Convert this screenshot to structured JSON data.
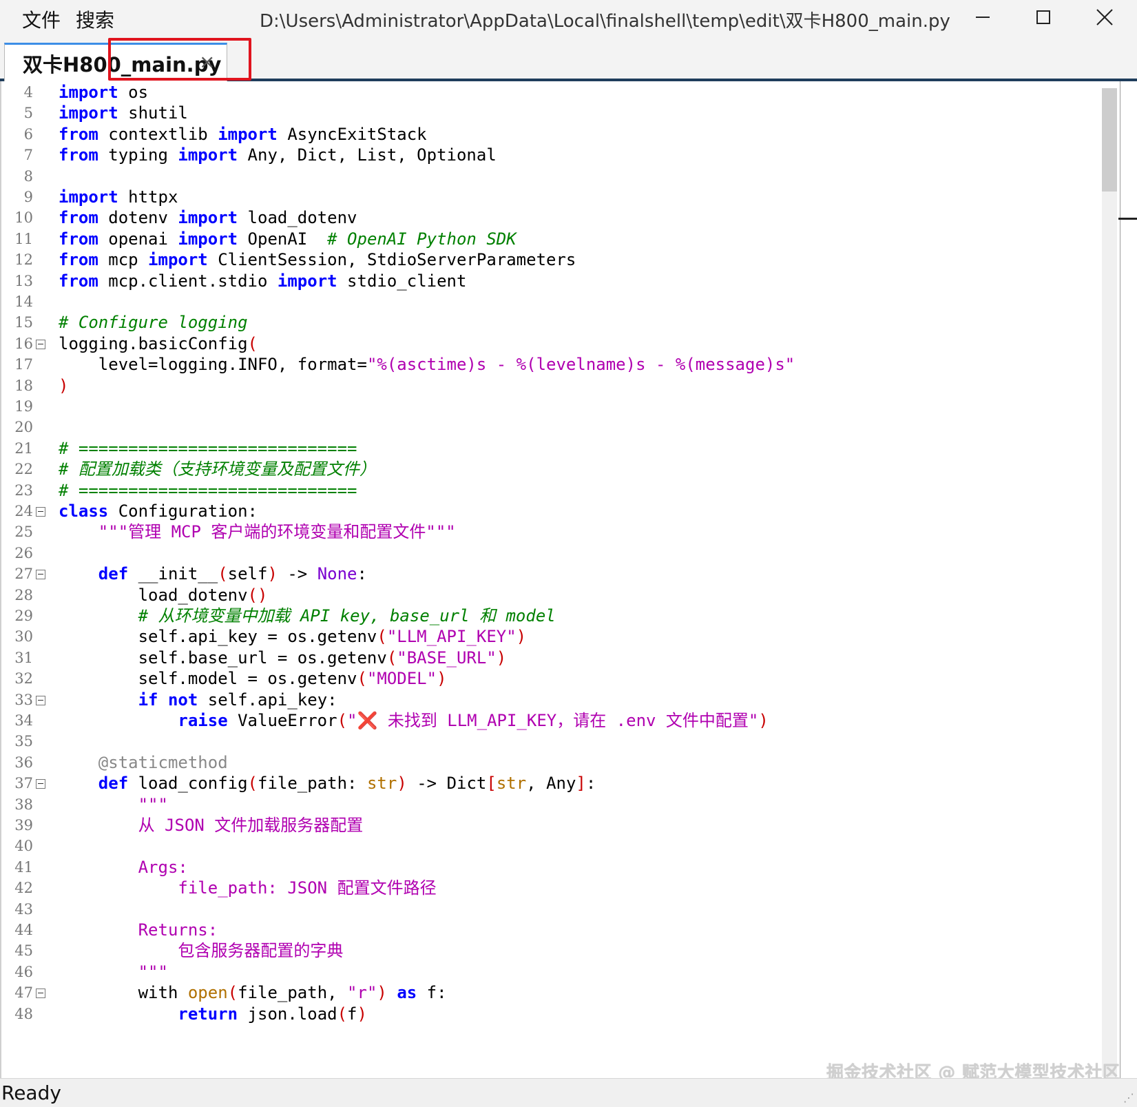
{
  "menu": {
    "file": "文件",
    "search": "搜索"
  },
  "window": {
    "title": "D:\\Users\\Administrator\\AppData\\Local\\finalshell\\temp\\edit\\双卡H800_main.py"
  },
  "tab": {
    "label": "双卡H800_main.py",
    "close": "×"
  },
  "status": {
    "text": "Ready"
  },
  "watermark": "掘金技术社区 @ 赋范大模型技术社区",
  "colors": {
    "keyword": "#0000ff",
    "comment": "#008000",
    "string": "#a31515",
    "docstring": "#b000b0",
    "highlight_box": "#e0141e",
    "tab_accent": "#3c8ee6"
  },
  "line_numbers": [
    "4",
    "5",
    "6",
    "7",
    "8",
    "9",
    "10",
    "11",
    "12",
    "13",
    "14",
    "15",
    "16",
    "17",
    "18",
    "19",
    "20",
    "21",
    "22",
    "23",
    "24",
    "25",
    "26",
    "27",
    "28",
    "29",
    "30",
    "31",
    "32",
    "33",
    "34",
    "35",
    "36",
    "37",
    "38",
    "39",
    "40",
    "41",
    "42",
    "43",
    "44",
    "45",
    "46",
    "47",
    "48"
  ],
  "code": {
    "import": "import",
    "from": "from",
    "class": "class",
    "def": "def",
    "if": "if",
    "not": "not",
    "raise": "raise",
    "return": "return",
    "as": "as",
    "l4": " os",
    "l5": " shutil",
    "l6a": " contextlib ",
    "l6b": " AsyncExitStack",
    "l7a": " typing ",
    "l7b": " Any, Dict, List, Optional",
    "l9": " httpx",
    "l10a": " dotenv ",
    "l10b": " load_dotenv",
    "l11a": " openai ",
    "l11b": " OpenAI  ",
    "l11c": "# OpenAI Python SDK",
    "l12a": " mcp ",
    "l12b": " ClientSession, StdioServerParameters",
    "l13a": " mcp.client.stdio ",
    "l13b": " stdio_client",
    "l15": "# Configure logging",
    "l16a": "logging.basicConfig",
    "l16b": "(",
    "l17a": "    level=logging.INFO, format=",
    "l17b": "\"%(asctime)s - %(levelname)s - %(message)s\"",
    "l18": ")",
    "l21": "# ============================",
    "l22": "# 配置加载类（支持环境变量及配置文件）",
    "l23": "# ============================",
    "l24": " Configuration:",
    "l25": "    \"\"\"管理 MCP 客户端的环境变量和配置文件\"\"\"",
    "l27a": "    ",
    "l27b": " __init__",
    "l27c": "(",
    "l27d": "self",
    "l27e": ")",
    "l27f": " -> ",
    "l27g": "None",
    "l27h": ":",
    "l28a": "        load_dotenv",
    "l28b": "()",
    "l29": "        # 从环境变量中加载 API key, base_url 和 model",
    "l30a": "        self.api_key = os.getenv",
    "l30b": "(",
    "l30c": "\"LLM_API_KEY\"",
    "l30d": ")",
    "l31a": "        self.base_url = os.getenv",
    "l31b": "(",
    "l31c": "\"BASE_URL\"",
    "l31d": ")",
    "l32a": "        self.model = os.getenv",
    "l32b": "(",
    "l32c": "\"MODEL\"",
    "l32d": ")",
    "l33a": "        ",
    "l33b": " self.api_key:",
    "l34a": "            ",
    "l34b": " ValueError",
    "l34c": "(",
    "l34d": "\"",
    "l34e": "❌",
    "l34f": " 未找到 LLM_API_KEY，请在 .env 文件中配置\"",
    "l34g": ")",
    "l36": "    @staticmethod",
    "l37a": "    ",
    "l37b": " load_config",
    "l37c": "(",
    "l37d": "file_path: ",
    "l37e": "str",
    "l37f": ")",
    "l37g": " -> Dict",
    "l37h": "[",
    "l37i": "str",
    "l37j": ", Any",
    "l37k": "]",
    "l37l": ":",
    "l38": "        \"\"\"",
    "l39": "        从 JSON 文件加载服务器配置",
    "l41": "        Args:",
    "l42": "            file_path: JSON 配置文件路径",
    "l44": "        Returns:",
    "l45": "            包含服务器配置的字典",
    "l46": "        \"\"\"",
    "l47a": "        with ",
    "l47b": "open",
    "l47c": "(",
    "l47d": "file_path, ",
    "l47e": "\"r\"",
    "l47f": ")",
    "l47g": " f:",
    "l48a": "            ",
    "l48b": " json.load",
    "l48c": "(",
    "l48d": "f",
    "l48e": ")"
  }
}
